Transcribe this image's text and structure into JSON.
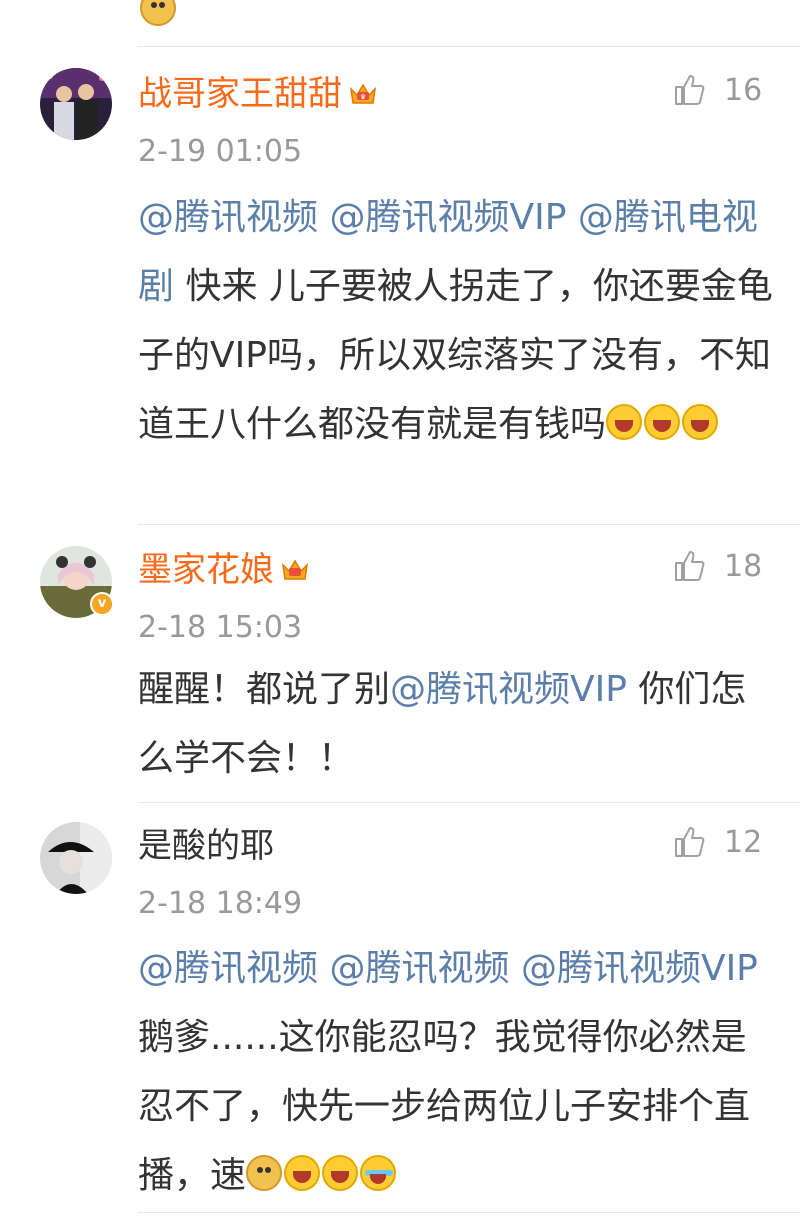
{
  "top_emoji": "doge-emoji",
  "comments": [
    {
      "username": "战哥家王甜甜",
      "username_color": "#f86a1a",
      "badge": "crown-icon",
      "likes": "16",
      "timestamp": "2-19 01:05",
      "body_parts": [
        {
          "type": "at",
          "text": "@腾讯视频"
        },
        {
          "type": "text",
          "text": " "
        },
        {
          "type": "at",
          "text": "@腾讯视频VIP"
        },
        {
          "type": "text",
          "text": " "
        },
        {
          "type": "at",
          "text": "@腾讯电视剧"
        },
        {
          "type": "text",
          "text": " 快来 儿子要被人拐走了，你还要金龟子的VIP吗，所以双综落实了没有，不知道王八什么都没有就是有钱吗"
        }
      ],
      "emojis": [
        "laugh-cry-emoji",
        "laugh-cry-emoji",
        "laugh-cry-emoji"
      ]
    },
    {
      "username": "墨家花娘",
      "username_color": "#f86a1a",
      "badge": "crown-icon",
      "likes": "18",
      "timestamp": "2-18 15:03",
      "body_parts": [
        {
          "type": "text",
          "text": "醒醒！都说了别"
        },
        {
          "type": "at",
          "text": "@腾讯视频VIP"
        },
        {
          "type": "text",
          "text": " 你们怎么学不会！！"
        }
      ],
      "emojis": []
    },
    {
      "username": "是酸的耶",
      "username_color": "#333333",
      "badge": "",
      "likes": "12",
      "timestamp": "2-18 18:49",
      "body_parts": [
        {
          "type": "at",
          "text": "@腾讯视频"
        },
        {
          "type": "text",
          "text": " "
        },
        {
          "type": "at",
          "text": "@腾讯视频"
        },
        {
          "type": "text",
          "text": " "
        },
        {
          "type": "at",
          "text": "@腾讯视频VIP"
        },
        {
          "type": "text",
          "text": " 鹅爹......这你能忍吗？我觉得你必然是忍不了，快先一步给两位儿子安排个直播，速"
        }
      ],
      "emojis": [
        "doge-emoji",
        "grin-emoji",
        "grin-emoji",
        "tears-emoji"
      ]
    }
  ],
  "colors": {
    "link": "#5b7fa8",
    "vip_name": "#f86a1a",
    "meta": "#999999"
  }
}
